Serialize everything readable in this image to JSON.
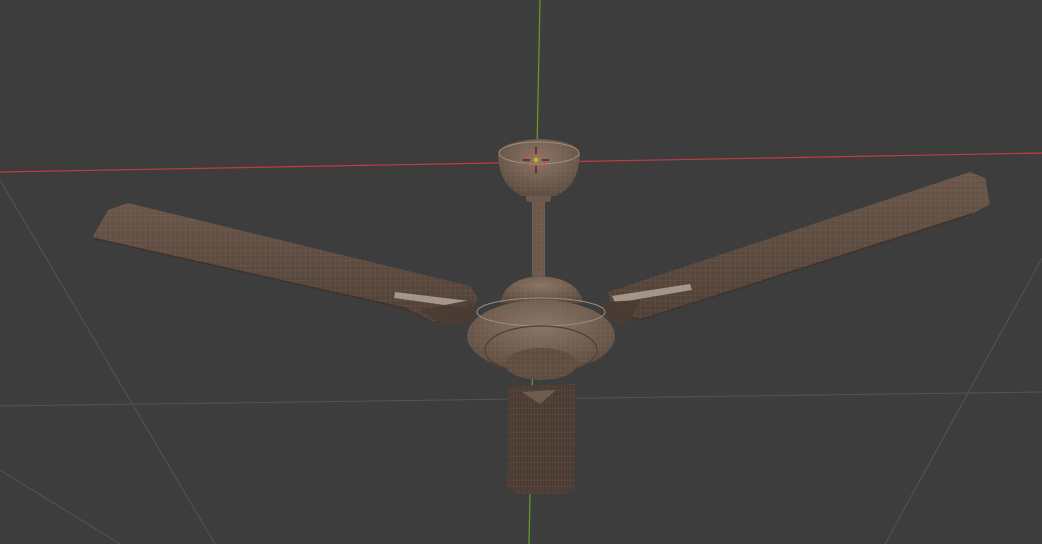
{
  "viewport": {
    "background": "#3d3d3d",
    "grid_color": "#545454",
    "x_axis_color": "#c23a48",
    "y_axis_color": "#6c9a2a",
    "grid_visible": true
  },
  "object": {
    "kind": "ceiling-fan",
    "display": "wireframe",
    "blade_count": 3,
    "base_color": "#5e4d40",
    "wire_color": "#8f7a6a"
  },
  "origin_marker": {
    "icon": "3d-cursor-icon",
    "color": "#d94848",
    "center_color": "#e8a020"
  }
}
